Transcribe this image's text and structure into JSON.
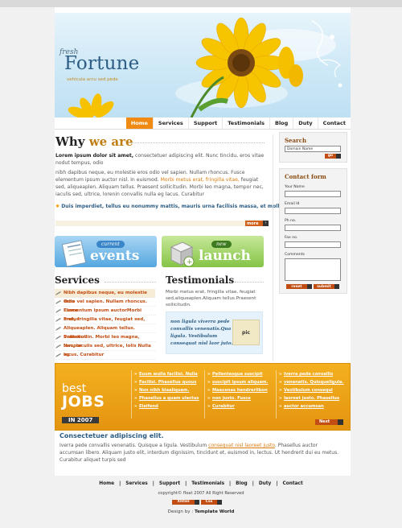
{
  "logo": {
    "fresh": "fresh",
    "name": "Fortune",
    "tagline": "vehicula arcu sed pede"
  },
  "nav": [
    "Home",
    "Services",
    "Support",
    "Testimonials",
    "Blog",
    "Duty",
    "Contact"
  ],
  "why": {
    "title_a": "Why ",
    "title_b": "we are",
    "p1_bold": "Lorem ipsum dolor sit amet,",
    "p1_rest": " consectetuer adipiscing elit. Nunc tincidu, eros vitae nodut tempus, odio",
    "p2_a": "nibh dapibus neque, eu molestie eros odio vel sapien. Nullam rhoncus. Fusce elementum ipsum auctor nisl. In euismod. ",
    "p2_orange": "Morbi metus erat, fringilla vitae,",
    "p2_b": " feugiat sed, aliqueaplen. Aliquam tellus. Praesent sollicitudin. Morbi leo magna, tempor nec, iaculis sed, ultrice, lorenin convallis nulla eg lacus. Curabitur",
    "bullet": "Duis imperdiet, tellus eu nonummy mattis, mauris urna facilisis massa, et molll",
    "more": "more"
  },
  "banners": {
    "events_small": "current",
    "events_big": "events",
    "launch_small": "new",
    "launch_big": "launch"
  },
  "services": {
    "title": "Services",
    "items": [
      "Nibh dapibus neque, eu molestie eros",
      "Odio vel sapien. Nullam rhoncus. Fusce",
      "Elementum ipsum auctorMorbi metus",
      "Erat, fringilla vitae, feugiat sed,",
      "Aliqueaplen. Aliquam tellus. Praesent",
      "Sollicitudin. Morbi leo magna, tempor",
      "Nec, iaculis sed, ultrice, lolis Nulla eg",
      "lacus. Curabitur"
    ]
  },
  "testimonials": {
    "title": "Testimonials",
    "text": "Morbi metus erat, fringilla vitae, feugiat sed,aliqueaplen.Aliquam tellus.Praesent sollicitudin.",
    "quote": "non ligula viverra pede convallis venenatis.Qua ligula. Vestibulum consequat nisl laor juto.",
    "pic": "pic"
  },
  "search": {
    "title": "Search",
    "placeholder": "Domain Name",
    "go": "go"
  },
  "contact": {
    "title": "Contact form",
    "labels": [
      "Your Name",
      "Email Id",
      "Ph no.",
      "Fax no.",
      "Comments"
    ],
    "reset": "reset",
    "submit": "submit"
  },
  "jobs": {
    "best": "best",
    "jobs": "JOBS",
    "year": "IN 2007",
    "col1": [
      "Eusm wulla facilisi. Nulla",
      "Facilisi. Phasellus quous",
      "Non nibh blaaliquam.",
      "Phasellus a quam ulectus",
      "Eleifend"
    ],
    "col2": [
      "Pellentesque suscipit",
      "suscipit ipsum aliquam.",
      "Maecenas hendrerlibon",
      "non justo. Fusce",
      "Curabitur"
    ],
    "col3": [
      "Iverra pede convallis",
      "venenatis. Quisqueligula.",
      "Vestibulum consequi",
      "laoreet justo. Phasellus",
      "auctor accumsan"
    ],
    "next": "Next"
  },
  "bottom": {
    "title": "Consectetuer adipiscing elit.",
    "text_a": "Iverra pede convallis venenatis. Quisque a ligula. Vestibulum ",
    "text_link": "consequat nisl laoreet justo",
    "text_b": ". Phasellus auctor accumsan libero. Aliquam justo elit, interdum dignissim, tincidunt et, euismod in, lectus. Ut hendrerit dui eu metus. Curabitur aliquet turpis sed"
  },
  "footer": {
    "links": [
      "Home",
      "Services",
      "Support",
      "Testimonials",
      "Blog",
      "Duty",
      "Contact"
    ],
    "separator": "|",
    "copyright": "copyright© float 2007 All Right Reserved",
    "valid1": "Xhtml",
    "valid2": "Css",
    "design_label": "Design by :",
    "design_name": "Template World"
  },
  "colors": {
    "accent_orange": "#f08a12",
    "brand_blue": "#2d5d84",
    "link_red": "#c24d12",
    "jobs_yellow": "#f4b01f"
  }
}
